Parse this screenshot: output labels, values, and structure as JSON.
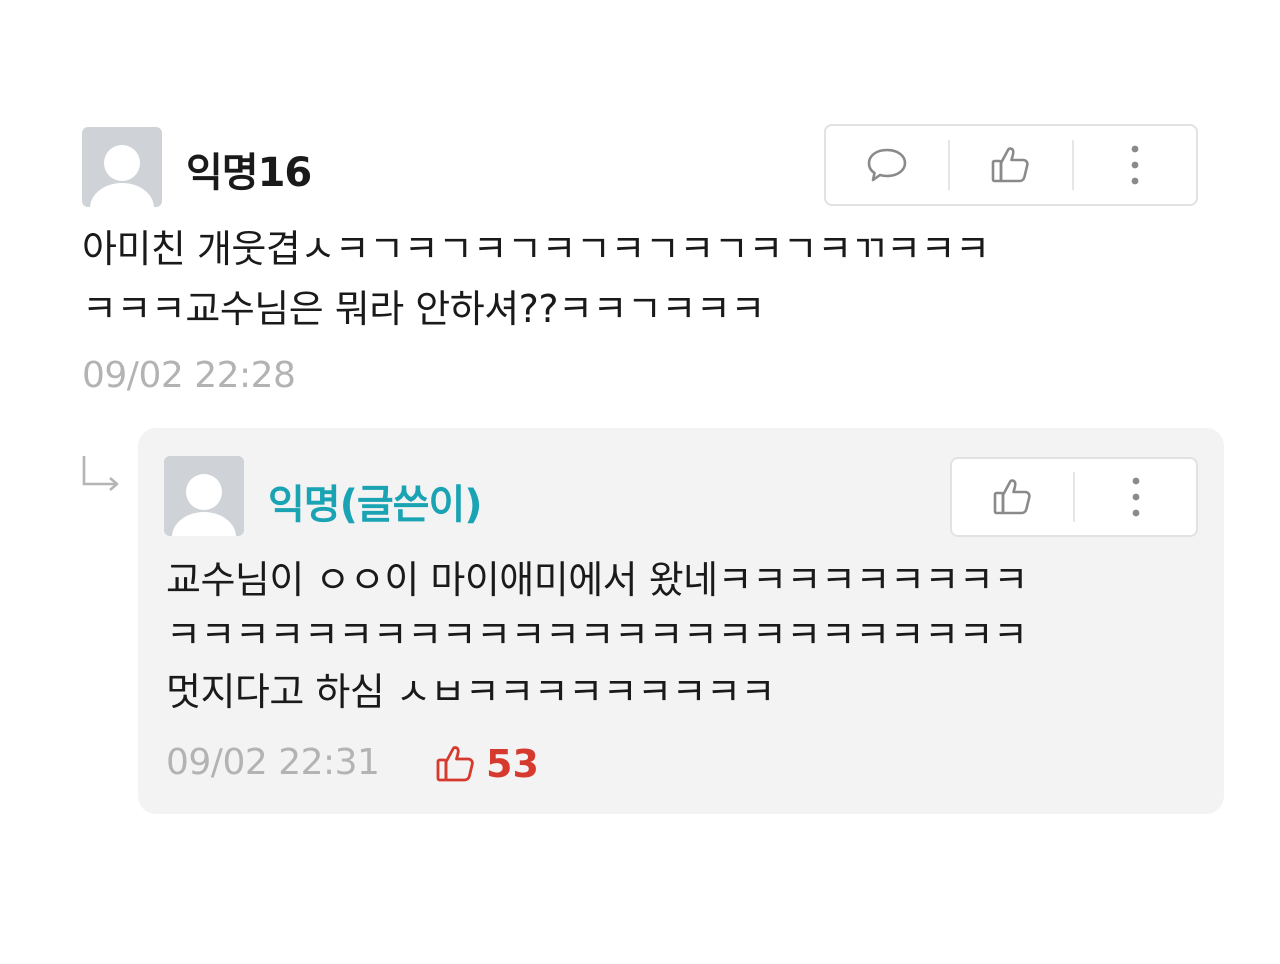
{
  "comment": {
    "nickname": "익명16",
    "text_line1": "아미친 개웃겹ㅅㅋㄱㅋㄱㅋㄱㅋㄱㅋㄱㅋㄱㅋㄱㅋㄲㅋㅋㅋ",
    "text_line2": "ㅋㅋㅋ교수님은 뭐라 안하셔??ㅋㅋㄱㅋㅋㅋ",
    "timestamp": "09/02 22:28",
    "icons": [
      "comment-icon",
      "thumbs-up-icon",
      "more-icon"
    ]
  },
  "reply": {
    "nickname": "익명(글쓴이)",
    "text_line1": "교수님이 ㅇㅇ이 마이애미에서 왔네ㅋㅋㅋㅋㅋㅋㅋㅋㅋ",
    "text_line2": "ㅋㅋㅋㅋㅋㅋㅋㅋㅋㅋㅋㅋㅋㅋㅋㅋㅋㅋㅋㅋㅋㅋㅋㅋㅋ",
    "text_line3": "멋지다고 하심 ㅅㅂㅋㅋㅋㅋㅋㅋㅋㅋㅋ",
    "timestamp": "09/02 22:31",
    "like_count": "53",
    "icons": [
      "thumbs-up-icon",
      "more-icon"
    ]
  },
  "colors": {
    "author_accent": "#1aa3b3",
    "like_red": "#d63a2f",
    "timestamp_gray": "#b3b3b3",
    "reply_background": "#f3f3f3"
  }
}
